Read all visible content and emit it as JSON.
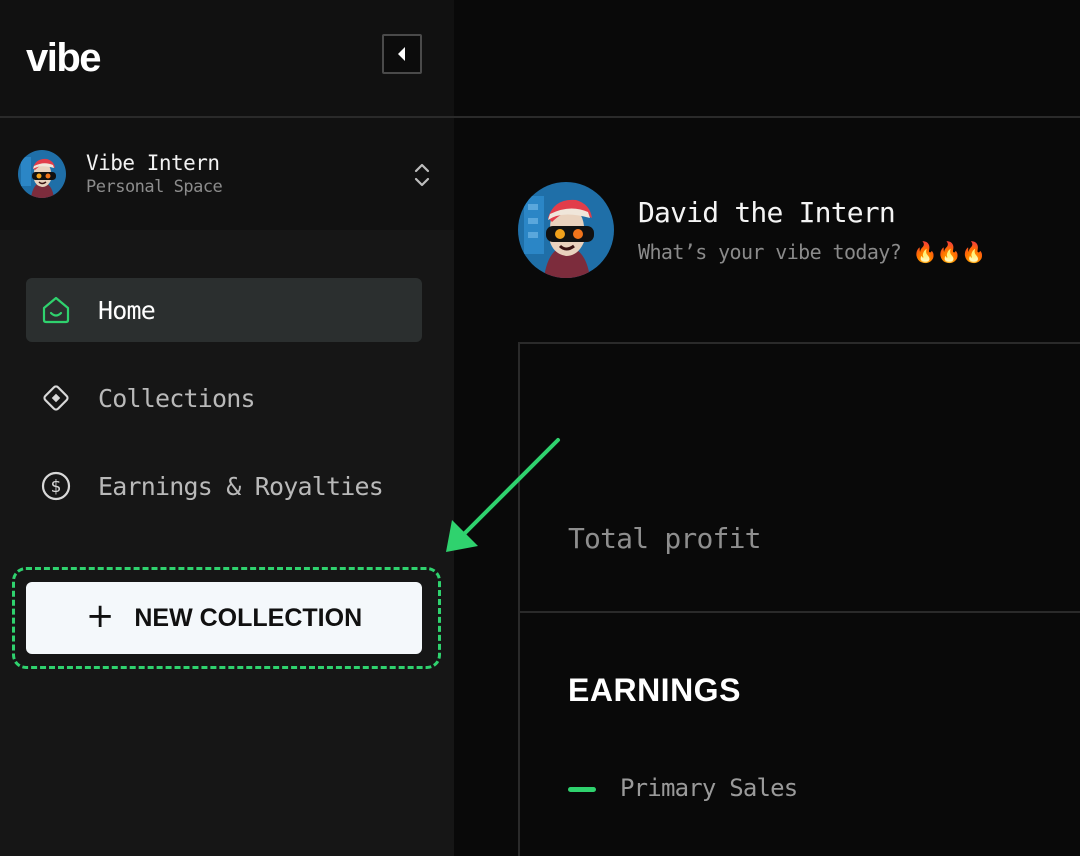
{
  "app": {
    "logo": "vibe"
  },
  "sidebar": {
    "collapse_icon": "chevron-left-icon",
    "space": {
      "name": "Vibe Intern",
      "subtitle": "Personal Space",
      "switch_icon": "chevron-up-down-icon"
    },
    "nav": [
      {
        "label": "Home",
        "icon": "home-icon",
        "active": true
      },
      {
        "label": "Collections",
        "icon": "diamond-icon",
        "active": false
      },
      {
        "label": "Earnings & Royalties",
        "icon": "dollar-circle-icon",
        "active": false
      }
    ],
    "new_collection": {
      "icon": "plus-icon",
      "label": "NEW COLLECTION"
    }
  },
  "profile": {
    "name": "David the Intern",
    "status": "What’s your vibe today? 🔥🔥🔥"
  },
  "dashboard": {
    "total_profit_label": "Total profit",
    "earnings_title": "EARNINGS",
    "legend": [
      {
        "label": "Primary Sales",
        "color": "#2fd26e"
      }
    ]
  },
  "annotation": {
    "highlight_color": "#2fd26e",
    "arrow_color": "#2fd26e"
  },
  "colors": {
    "accent": "#2fd26e",
    "background": "#090909",
    "sidebar": "#161616",
    "active_nav": "#2b2f2f"
  }
}
